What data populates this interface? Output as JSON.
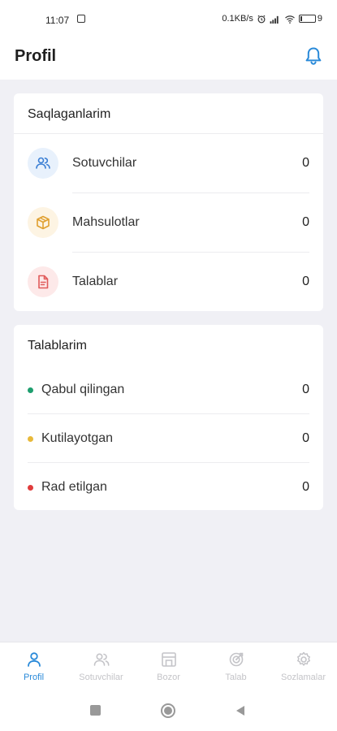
{
  "status_bar": {
    "time": "11:07",
    "network_speed": "0.1KB/s",
    "battery": "9"
  },
  "header": {
    "title": "Profil",
    "notification_icon": "bell-icon",
    "accent_color": "#2a8ad9"
  },
  "saved": {
    "title": "Saqlaganlarim",
    "items": [
      {
        "label": "Sotuvchilar",
        "count": "0",
        "icon": "users-icon",
        "icon_color": "#3b7fd4",
        "bg_color": "#e8f1fc"
      },
      {
        "label": "Mahsulotlar",
        "count": "0",
        "icon": "box-icon",
        "icon_color": "#e0a030",
        "bg_color": "#fdf4e3"
      },
      {
        "label": "Talablar",
        "count": "0",
        "icon": "document-icon",
        "icon_color": "#e05a5a",
        "bg_color": "#fde9e9"
      }
    ]
  },
  "requests": {
    "title": "Talablarim",
    "items": [
      {
        "label": "Qabul qilingan",
        "count": "0",
        "dot_color": "#1e9e6e"
      },
      {
        "label": "Kutilayotgan",
        "count": "0",
        "dot_color": "#e8b93a"
      },
      {
        "label": "Rad etilgan",
        "count": "0",
        "dot_color": "#e03c3c"
      }
    ]
  },
  "bottom_nav": {
    "items": [
      {
        "label": "Profil",
        "icon": "person-icon",
        "active": true
      },
      {
        "label": "Sotuvchilar",
        "icon": "users-icon",
        "active": false
      },
      {
        "label": "Bozor",
        "icon": "store-icon",
        "active": false
      },
      {
        "label": "Talab",
        "icon": "target-icon",
        "active": false
      },
      {
        "label": "Sozlamalar",
        "icon": "gear-icon",
        "active": false
      }
    ]
  }
}
